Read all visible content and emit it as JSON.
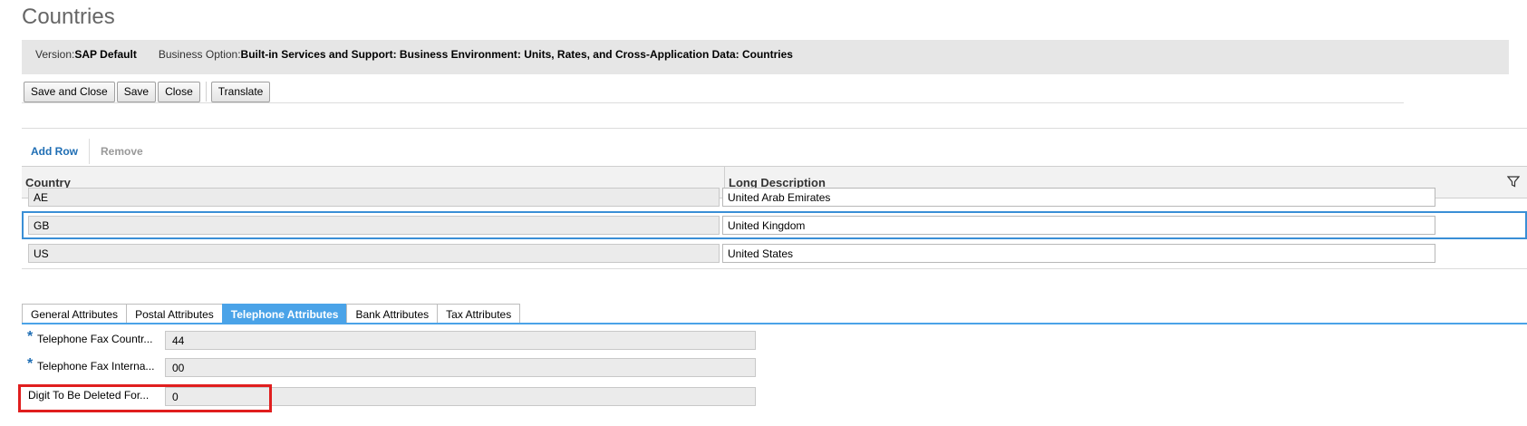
{
  "page": {
    "title": "Countries"
  },
  "info": {
    "version_label": "Version:",
    "version_value": "SAP Default",
    "business_option_label": "Business Option:",
    "business_option_value": "Built-in Services and Support: Business Environment: Units, Rates, and Cross-Application Data: Countries"
  },
  "toolbar": {
    "save_close": "Save and Close",
    "save": "Save",
    "close": "Close",
    "translate": "Translate"
  },
  "row_actions": {
    "add_row": "Add Row",
    "remove": "Remove"
  },
  "grid": {
    "columns": [
      "Country",
      "Long Description"
    ],
    "rows": [
      {
        "country": "AE",
        "description": "United Arab Emirates",
        "selected": false
      },
      {
        "country": "GB",
        "description": "United Kingdom",
        "selected": true
      },
      {
        "country": "US",
        "description": "United States",
        "selected": false
      }
    ]
  },
  "tabs": [
    "General Attributes",
    "Postal Attributes",
    "Telephone Attributes",
    "Bank Attributes",
    "Tax Attributes"
  ],
  "active_tab": "Telephone Attributes",
  "fields": [
    {
      "label": "Telephone Fax Countr...",
      "value": "44",
      "required": true
    },
    {
      "label": "Telephone Fax Interna...",
      "value": "00",
      "required": true
    },
    {
      "label": "Digit To Be Deleted For...",
      "value": "0",
      "required": false,
      "highlighted": true
    }
  ],
  "colors": {
    "accent": "#4aa3e8",
    "link": "#1f6eb4",
    "highlight": "#e01e1e"
  },
  "icons": {
    "filter": "filter-icon"
  }
}
